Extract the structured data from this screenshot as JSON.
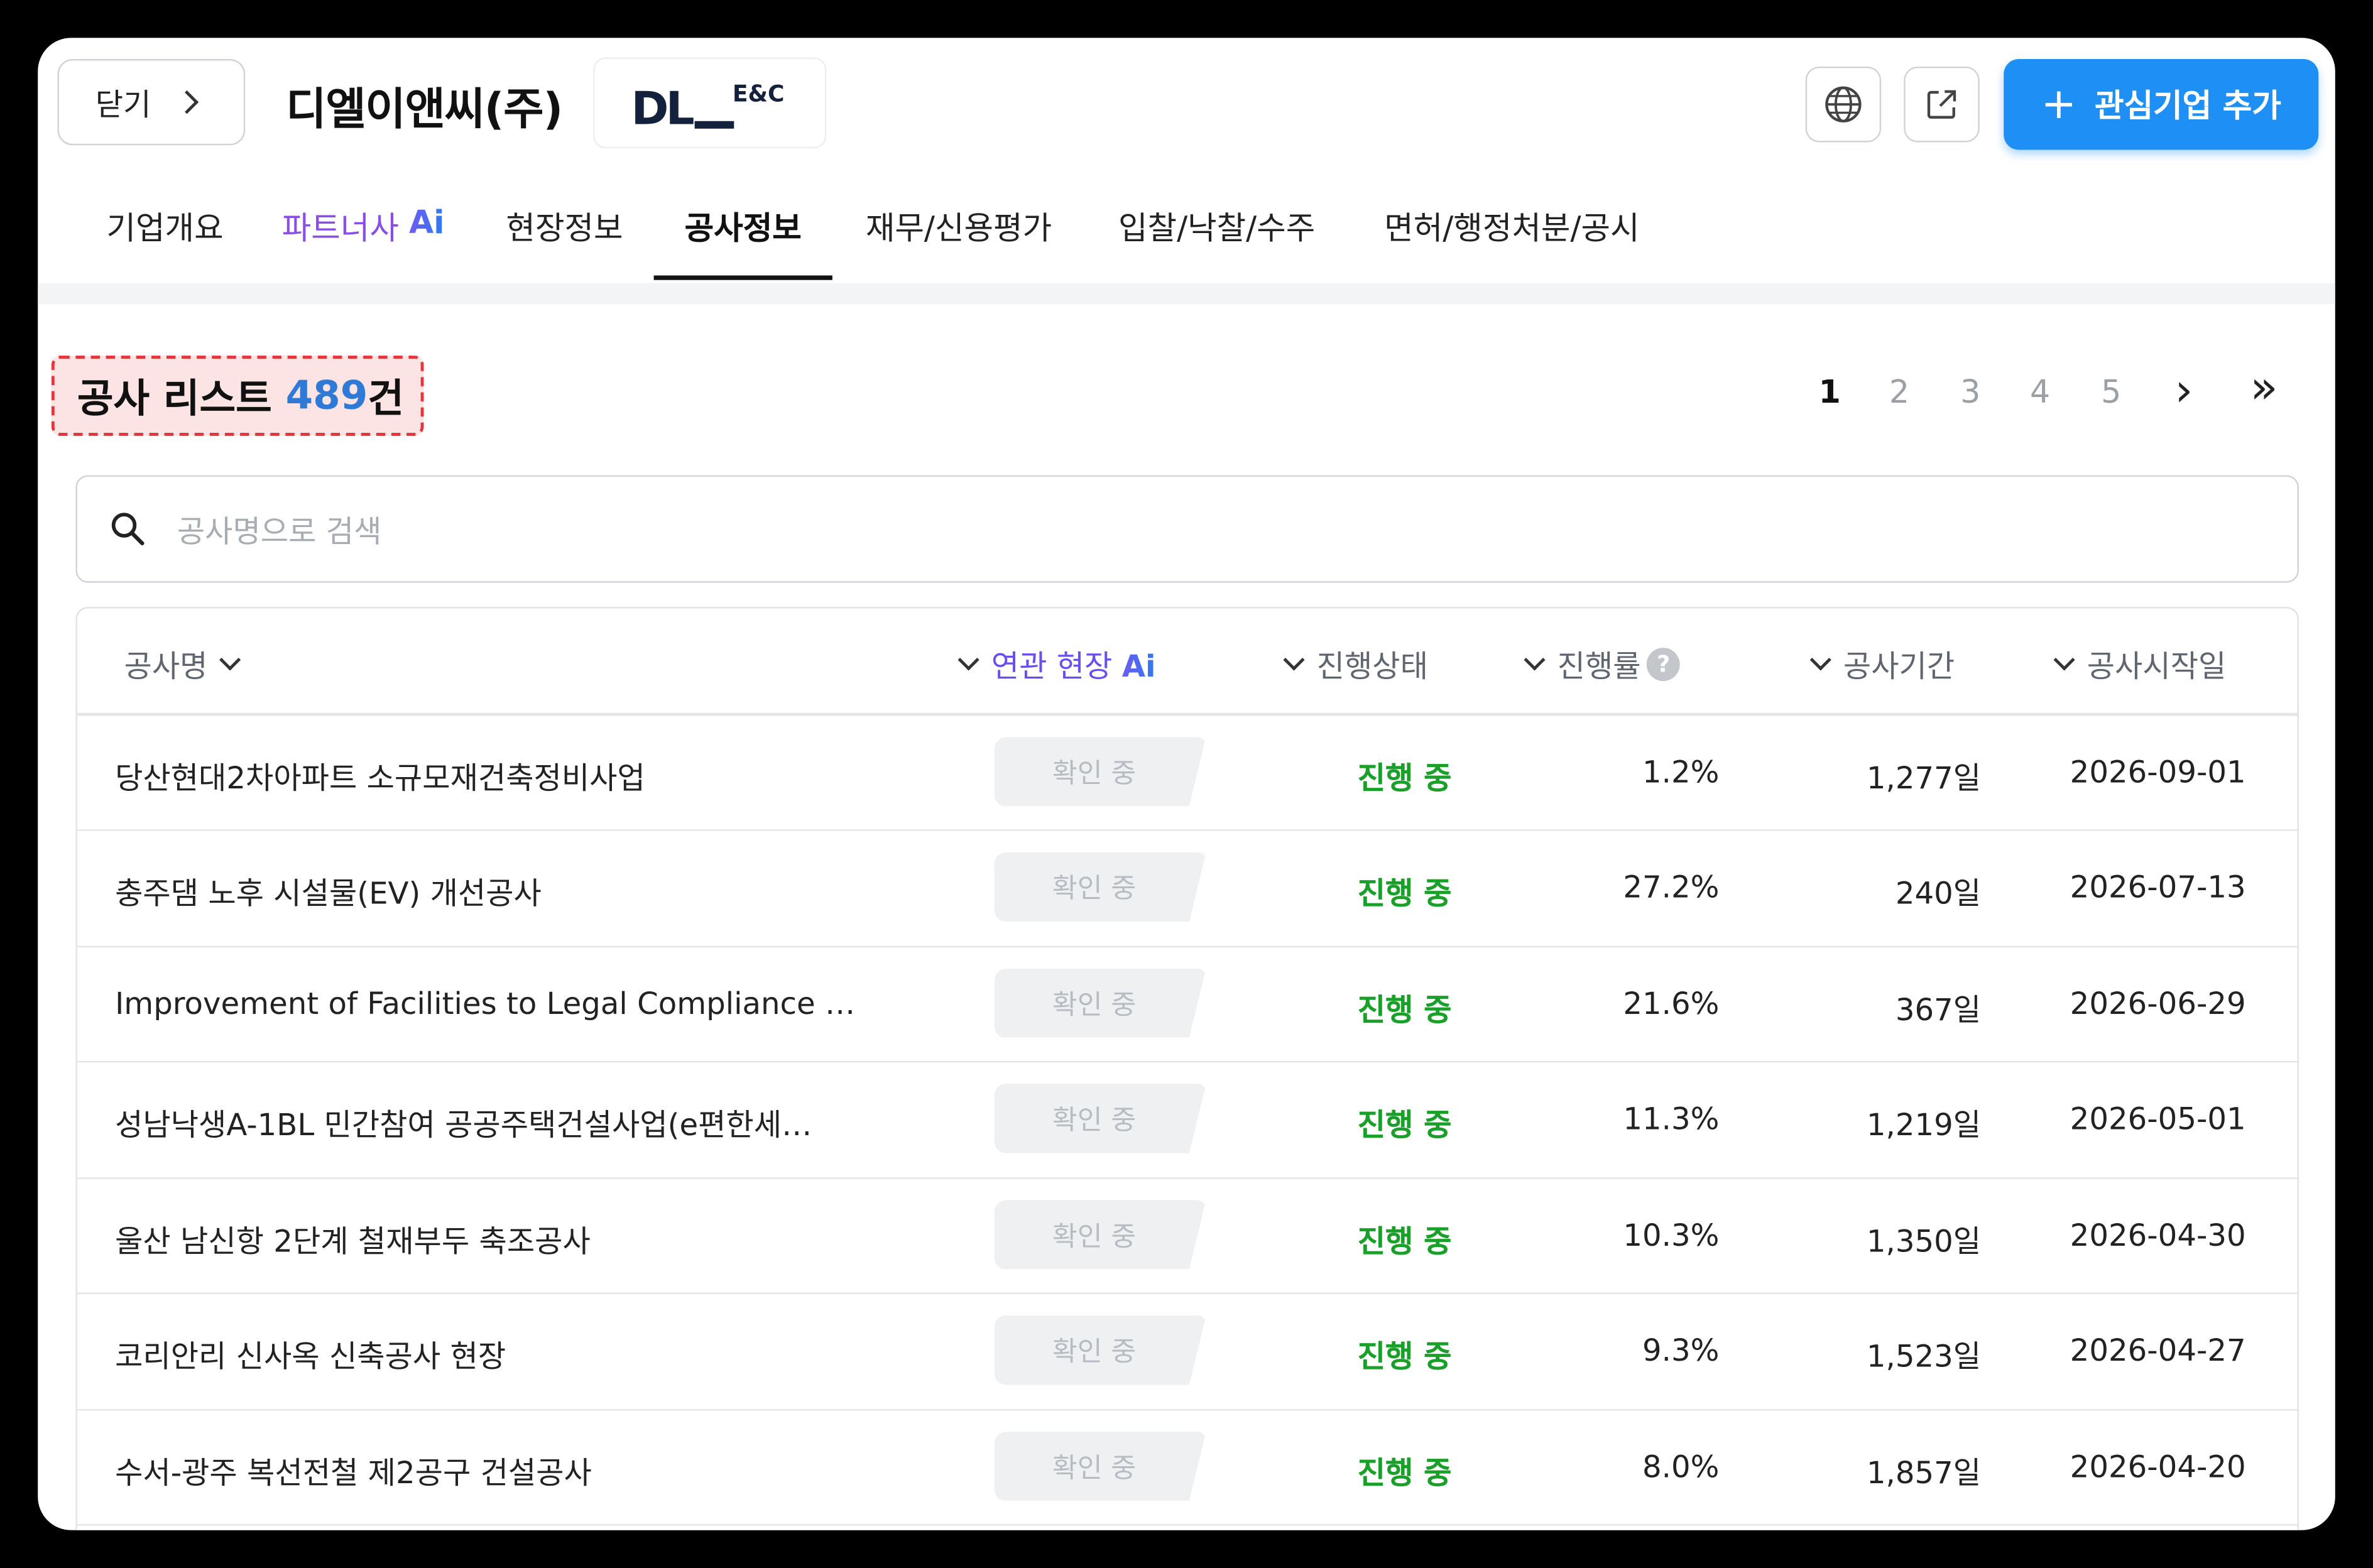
{
  "header": {
    "close_label": "닫기",
    "company_name": "디엘이앤씨(주)",
    "logo_mark": "DL",
    "logo_sub": "E&C",
    "add_button_label": "관심기업 추가",
    "add_button_plus": "+"
  },
  "tabs": [
    {
      "label": "기업개요"
    },
    {
      "label": "파트너사",
      "ai": "Ai"
    },
    {
      "label": "현장정보"
    },
    {
      "label": "공사정보"
    },
    {
      "label": "재무/신용평가"
    },
    {
      "label": "입찰/낙찰/수주"
    },
    {
      "label": "면허/행정처분/공시"
    }
  ],
  "list": {
    "title_prefix": "공사 리스트",
    "count": "489",
    "title_suffix": "건"
  },
  "pagination": {
    "pages": [
      "1",
      "2",
      "3",
      "4",
      "5"
    ],
    "current": "1",
    "next": "›",
    "last": "»"
  },
  "search": {
    "placeholder": "공사명으로 검색",
    "value": ""
  },
  "table": {
    "columns": {
      "name": "공사명",
      "related_site": "연관 현장",
      "related_site_ai": "Ai",
      "status": "진행상태",
      "rate": "진행률",
      "rate_help": "?",
      "period": "공사기간",
      "start_date": "공사시작일"
    },
    "rows": [
      {
        "name": "당산현대2차아파트 소규모재건축정비사업",
        "site": "확인 중",
        "status": "진행 중",
        "rate": "1.2%",
        "period": "1,277일",
        "start": "2026-09-01"
      },
      {
        "name": "충주댐 노후 시설물(EV) 개선공사",
        "site": "확인 중",
        "status": "진행 중",
        "rate": "27.2%",
        "period": "240일",
        "start": "2026-07-13"
      },
      {
        "name": "Improvement of Facilities to Legal Compliance …",
        "site": "확인 중",
        "status": "진행 중",
        "rate": "21.6%",
        "period": "367일",
        "start": "2026-06-29"
      },
      {
        "name": "성남낙생A-1BL 민간참여 공공주택건설사업(e편한세…",
        "site": "확인 중",
        "status": "진행 중",
        "rate": "11.3%",
        "period": "1,219일",
        "start": "2026-05-01"
      },
      {
        "name": "울산 남신항 2단계 철재부두 축조공사",
        "site": "확인 중",
        "status": "진행 중",
        "rate": "10.3%",
        "period": "1,350일",
        "start": "2026-04-30"
      },
      {
        "name": "코리안리 신사옥 신축공사 현장",
        "site": "확인 중",
        "status": "진행 중",
        "rate": "9.3%",
        "period": "1,523일",
        "start": "2026-04-27"
      },
      {
        "name": "수서-광주 복선전철 제2공구 건설공사",
        "site": "확인 중",
        "status": "진행 중",
        "rate": "8.0%",
        "period": "1,857일",
        "start": "2026-04-20"
      }
    ]
  },
  "colors": {
    "accent": "#1e8ff5",
    "status_ok": "#18a028",
    "highlight_border": "#e5353b",
    "count_blue": "#2f7ad6"
  }
}
